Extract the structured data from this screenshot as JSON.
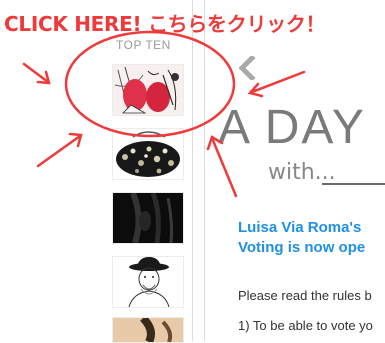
{
  "call_to_action": {
    "text": "CLICK HERE! こちらをクリック！",
    "color": "#ee3a3a"
  },
  "sidebar": {
    "title": "TOP TEN",
    "items": [
      {
        "icon": "fashion-illustration-thumbnail"
      },
      {
        "icon": "embellished-bag-thumbnail"
      },
      {
        "icon": "dark-photo-thumbnail"
      },
      {
        "icon": "hat-man-sketch-thumbnail"
      },
      {
        "icon": "partial-photo-thumbnail"
      }
    ]
  },
  "nav": {
    "prev_icon": "chevron-left-icon"
  },
  "banner": {
    "title": "A DAY",
    "subtitle": "with..."
  },
  "article": {
    "headline_line1": "Luisa Via Roma's",
    "headline_line2": "Voting is now ope",
    "para1": "Please read the rules b",
    "para2": "1) To be able to vote yo",
    "headline_color": "#1e90e6"
  }
}
